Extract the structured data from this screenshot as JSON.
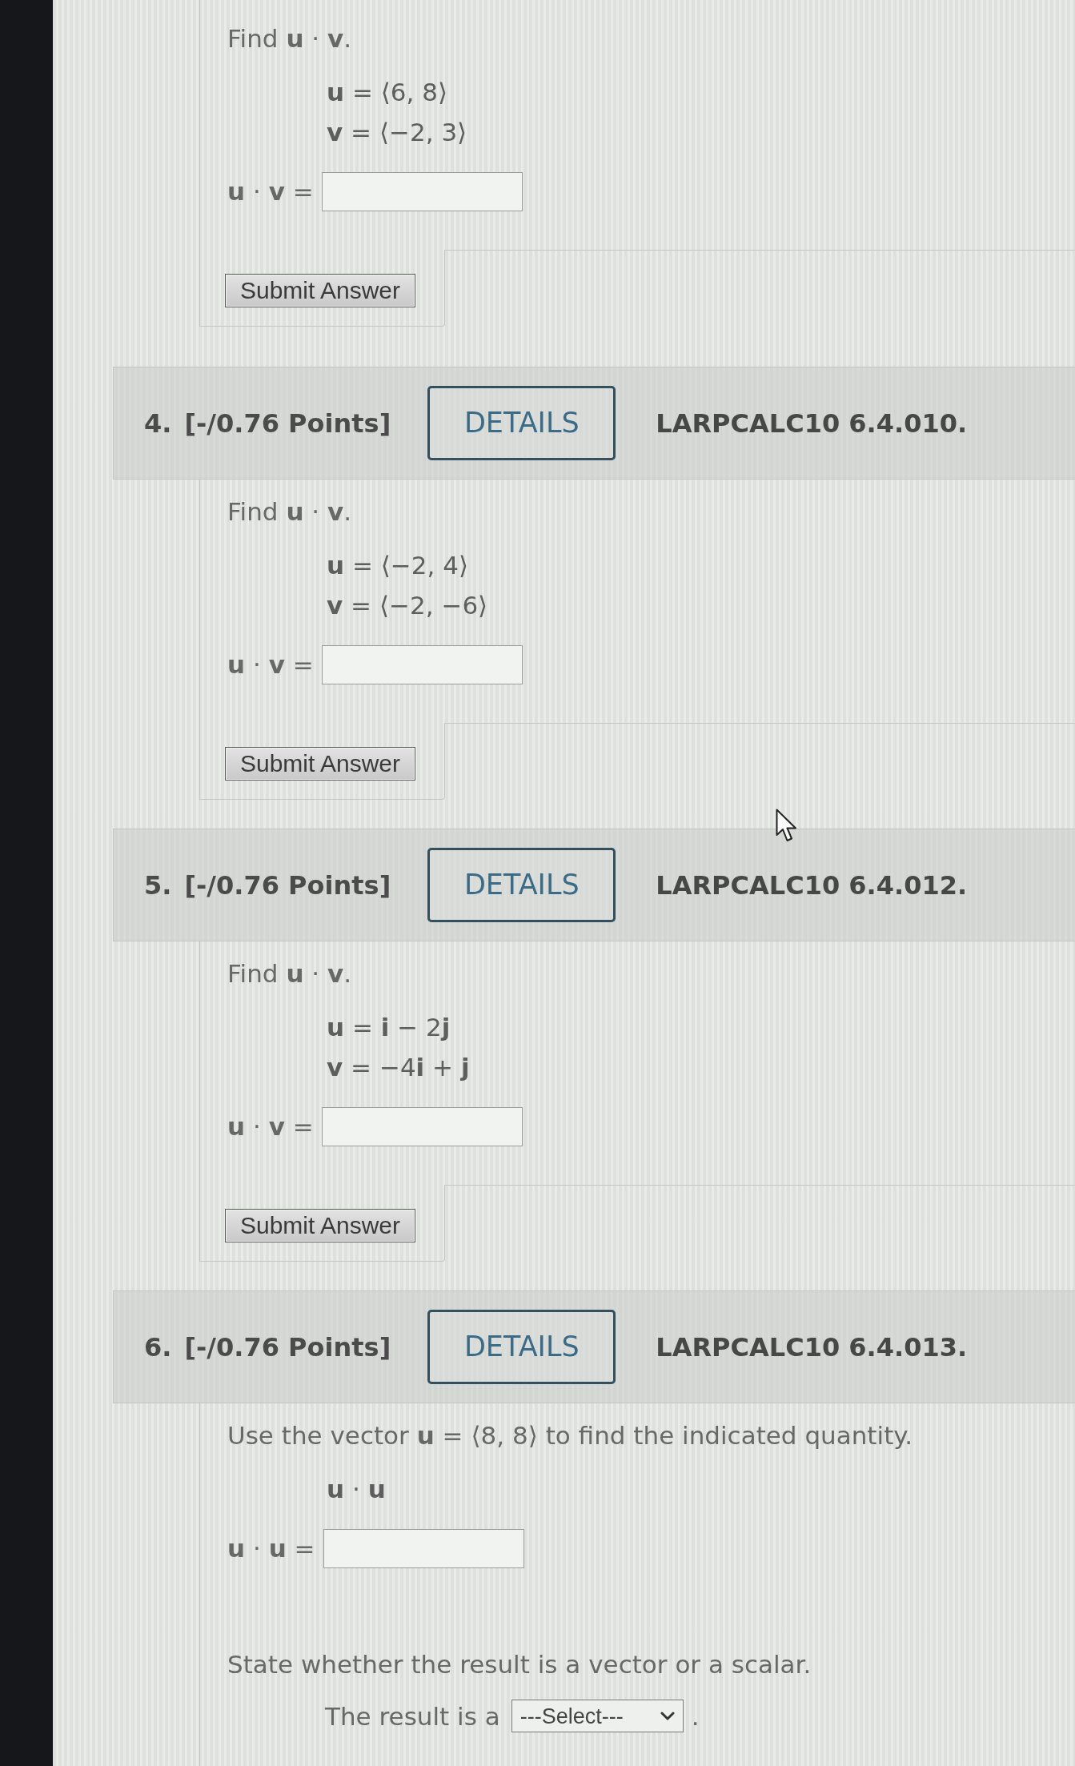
{
  "questions": [
    {
      "body": [
        {
          "kind": "text",
          "text": "Find **u** · **v**."
        },
        {
          "kind": "equation",
          "lines": [
            "**u** = ⟨6, 8⟩",
            "**v** = ⟨−2, 3⟩"
          ]
        },
        {
          "kind": "answer",
          "label": "**u** · **v** ="
        },
        {
          "kind": "submit",
          "label": "Submit Answer"
        }
      ]
    },
    {
      "header": {
        "number": "4.",
        "points": "[-/0.76 Points]",
        "details": "DETAILS",
        "code": "LARPCALC10 6.4.010."
      },
      "body": [
        {
          "kind": "text",
          "text": "Find **u** · **v**."
        },
        {
          "kind": "equation",
          "lines": [
            "**u** = ⟨−2, 4⟩",
            "**v** = ⟨−2, −6⟩"
          ]
        },
        {
          "kind": "answer",
          "label": "**u** · **v** ="
        },
        {
          "kind": "submit",
          "label": "Submit Answer"
        }
      ]
    },
    {
      "header": {
        "number": "5.",
        "points": "[-/0.76 Points]",
        "details": "DETAILS",
        "code": "LARPCALC10 6.4.012."
      },
      "body": [
        {
          "kind": "text",
          "text": "Find **u** · **v**."
        },
        {
          "kind": "equation",
          "lines": [
            "**u** = **i** − 2**j**",
            "**v** = −4**i** + **j**"
          ]
        },
        {
          "kind": "answer",
          "label": "**u** · **v** ="
        },
        {
          "kind": "submit",
          "label": "Submit Answer"
        }
      ]
    },
    {
      "header": {
        "number": "6.",
        "points": "[-/0.76 Points]",
        "details": "DETAILS",
        "code": "LARPCALC10 6.4.013."
      },
      "body": [
        {
          "kind": "text",
          "text": "Use the vector **u** = ⟨8, 8⟩ to find the indicated quantity."
        },
        {
          "kind": "equation",
          "lines": [
            "**u** · **u**"
          ]
        },
        {
          "kind": "answer",
          "label": "**u** · **u** ="
        },
        {
          "kind": "text",
          "text": "State whether the result is a vector or a scalar."
        },
        {
          "kind": "choice",
          "before": "The result is a",
          "select": "---Select---",
          "after": "."
        }
      ]
    }
  ]
}
